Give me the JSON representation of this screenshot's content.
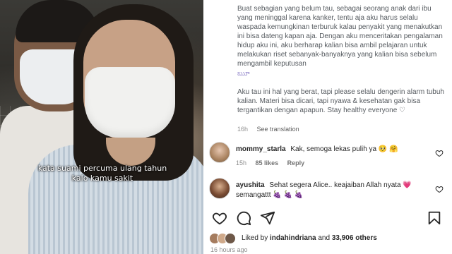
{
  "photo": {
    "overlay_line1": "kata suami percuma ulang tahun",
    "overlay_line2": "kalo kamu sakit"
  },
  "post": {
    "caption_p1": "Buat sebagian yang belum tau, sebagai seorang anak dari ibu yang meninggal karena kanker, tentu aja aku harus selalu waspada kemungkinan terburuk kalau penyakit yang menakutkan ini bisa dateng kapan aja. Dengan aku menceritakan pengalaman hidup aku ini, aku berharap kalian bisa ambil pelajaran untuk melakukan riset sebanyak-banyaknya yang kalian bisa sebelum mengambil keputusan",
    "caption_emoji": "ౠ",
    "caption_p2": "Aku tau ini hal yang berat, tapi please selalu dengerin alarm tubuh kalian. Materi bisa dicari, tapi nyawa & kesehatan gak bisa tergantikan dengan apapun. Stay healthy everyone ♡",
    "time": "16h",
    "see_translation": "See translation"
  },
  "comments": [
    {
      "user": "mommy_starla",
      "text": "Kak, semoga lekas pulih ya 🥺 🤗",
      "time": "15h",
      "likes": "85 likes",
      "reply": "Reply"
    },
    {
      "user": "ayushita",
      "text": "Sehat segera Alice.. keajaiban Allah nyata 💗 semangattt 🍇 🍇 🍇",
      "time": "",
      "likes": "",
      "reply": ""
    }
  ],
  "likes": {
    "prefix": "Liked by ",
    "user": "indahindriana",
    "middle": " and ",
    "count": "33,906 others"
  },
  "time_ago": "16 hours ago",
  "icons": [
    "heart-icon",
    "comment-icon",
    "share-icon",
    "bookmark-icon"
  ],
  "colors": {
    "like_red": "#ed4956",
    "muted": "#8e8e8e",
    "text": "#262626"
  }
}
